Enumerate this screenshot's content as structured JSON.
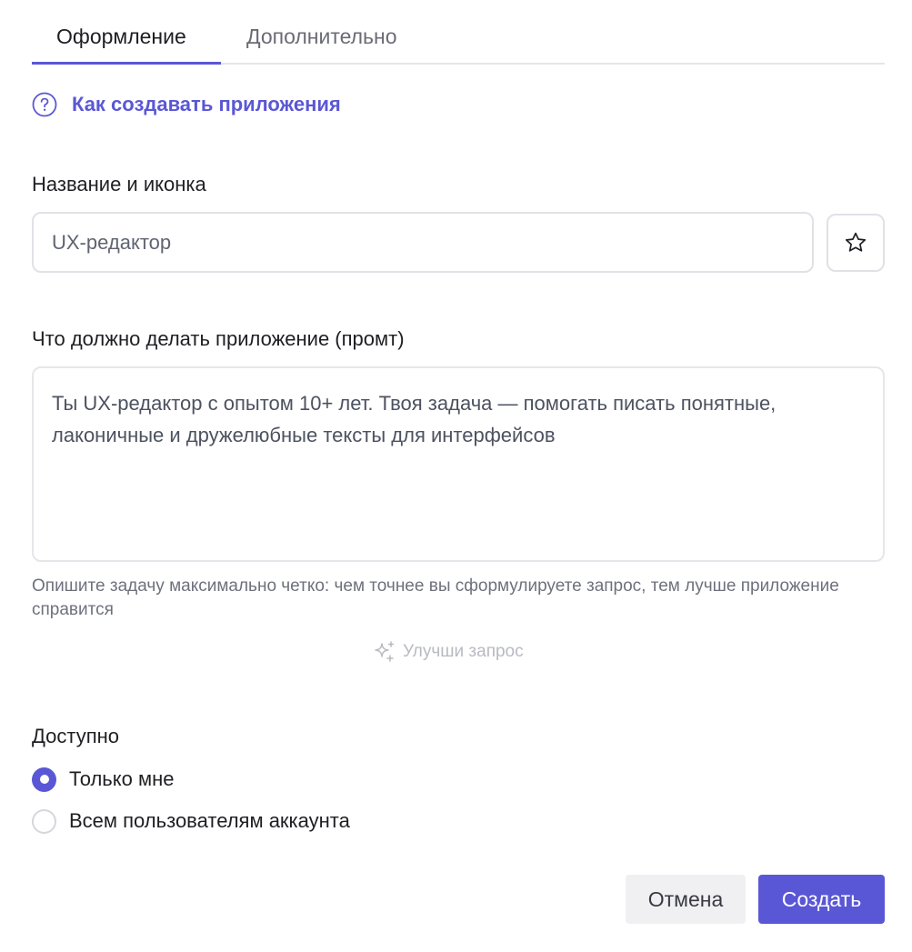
{
  "tabs": [
    {
      "label": "Оформление",
      "active": true
    },
    {
      "label": "Дополнительно",
      "active": false
    }
  ],
  "help_link": {
    "icon": "question-circle-icon",
    "label": "Как создавать приложения"
  },
  "name_section": {
    "label": "Название и иконка",
    "input_value": "UX-редактор",
    "icon_button_icon": "star-icon"
  },
  "prompt_section": {
    "label": "Что должно делать приложение (промт)",
    "value": "Ты UX-редактор с опытом 10+ лет. Твоя задача — помогать писать понятные, лаконичные и дружелюбные тексты для интерфейсов",
    "hint": "Опишите задачу максимально четко: чем точнее вы сформулируете запрос, тем лучше приложение справится",
    "improve_icon": "sparkles-icon",
    "improve_label": "Улучши запрос"
  },
  "access": {
    "label": "Доступно",
    "options": [
      {
        "label": "Только мне",
        "selected": true
      },
      {
        "label": "Всем пользователям аккаунта",
        "selected": false
      }
    ]
  },
  "actions": {
    "cancel_label": "Отмена",
    "create_label": "Создать"
  },
  "colors": {
    "accent": "#5a57d6",
    "text": "#1f1f23",
    "muted": "#6e717c",
    "border": "#e1e1e6",
    "disabled": "#b8bac2"
  }
}
